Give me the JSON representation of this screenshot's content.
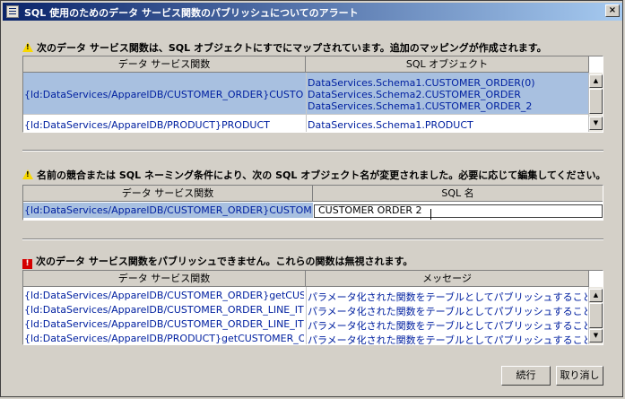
{
  "window": {
    "title": "SQL 使用のためのデータ サービス関数のパブリッシュについてのアラート",
    "close": "×"
  },
  "section1": {
    "message": "次のデータ サービス関数は、SQL オブジェクトにすでにマップされています。追加のマッピングが作成されます。",
    "columns": [
      "データ サービス関数",
      "SQL オブジェクト"
    ],
    "rows": [
      {
        "function": "{ld:DataServices/ApparelDB/CUSTOMER_ORDER}CUSTO...",
        "objects": [
          "DataServices.Schema1.CUSTOMER_ORDER(0)",
          "DataServices.Schema2.CUSTOMER_ORDER",
          "DataServices.Schema1.CUSTOMER_ORDER_2"
        ]
      },
      {
        "function": "{ld:DataServices/ApparelDB/PRODUCT}PRODUCT",
        "objects": [
          "DataServices.Schema1.PRODUCT"
        ]
      }
    ]
  },
  "section2": {
    "message": "名前の競合または SQL ネーミング条件により、次の SQL オブジェクト名が変更されました。必要に応じて編集してください。",
    "columns": [
      "データ サービス関数",
      "SQL 名"
    ],
    "row": {
      "function": "{ld:DataServices/ApparelDB/CUSTOMER_ORDER}CUSTOME...",
      "sql_name": "CUSTOMER ORDER 2"
    }
  },
  "section3": {
    "message": "次のデータ サービス関数をパブリッシュできません。これらの関数は無視されます。",
    "columns": [
      "データ サービス関数",
      "メッセージ"
    ],
    "rows": [
      {
        "function": "{ld:DataServices/ApparelDB/CUSTOMER_ORDER}getCUST...",
        "message": "パラメータ化された関数をテーブルとしてパブリッシュすることはできま..."
      },
      {
        "function": "{ld:DataServices/ApparelDB/CUSTOMER_ORDER_LINE_ITE...",
        "message": "パラメータ化された関数をテーブルとしてパブリッシュすることはできま..."
      },
      {
        "function": "{ld:DataServices/ApparelDB/CUSTOMER_ORDER_LINE_ITE...",
        "message": "パラメータ化された関数をテーブルとしてパブリッシュすることはできま..."
      },
      {
        "function": "{ld:DataServices/ApparelDB/PRODUCT}getCUSTOMER_O...",
        "message": "パラメータ化された関数をテーブルとしてパブリッシュすることはできま..."
      }
    ]
  },
  "buttons": {
    "continue": "続行",
    "cancel": "取り消し"
  }
}
